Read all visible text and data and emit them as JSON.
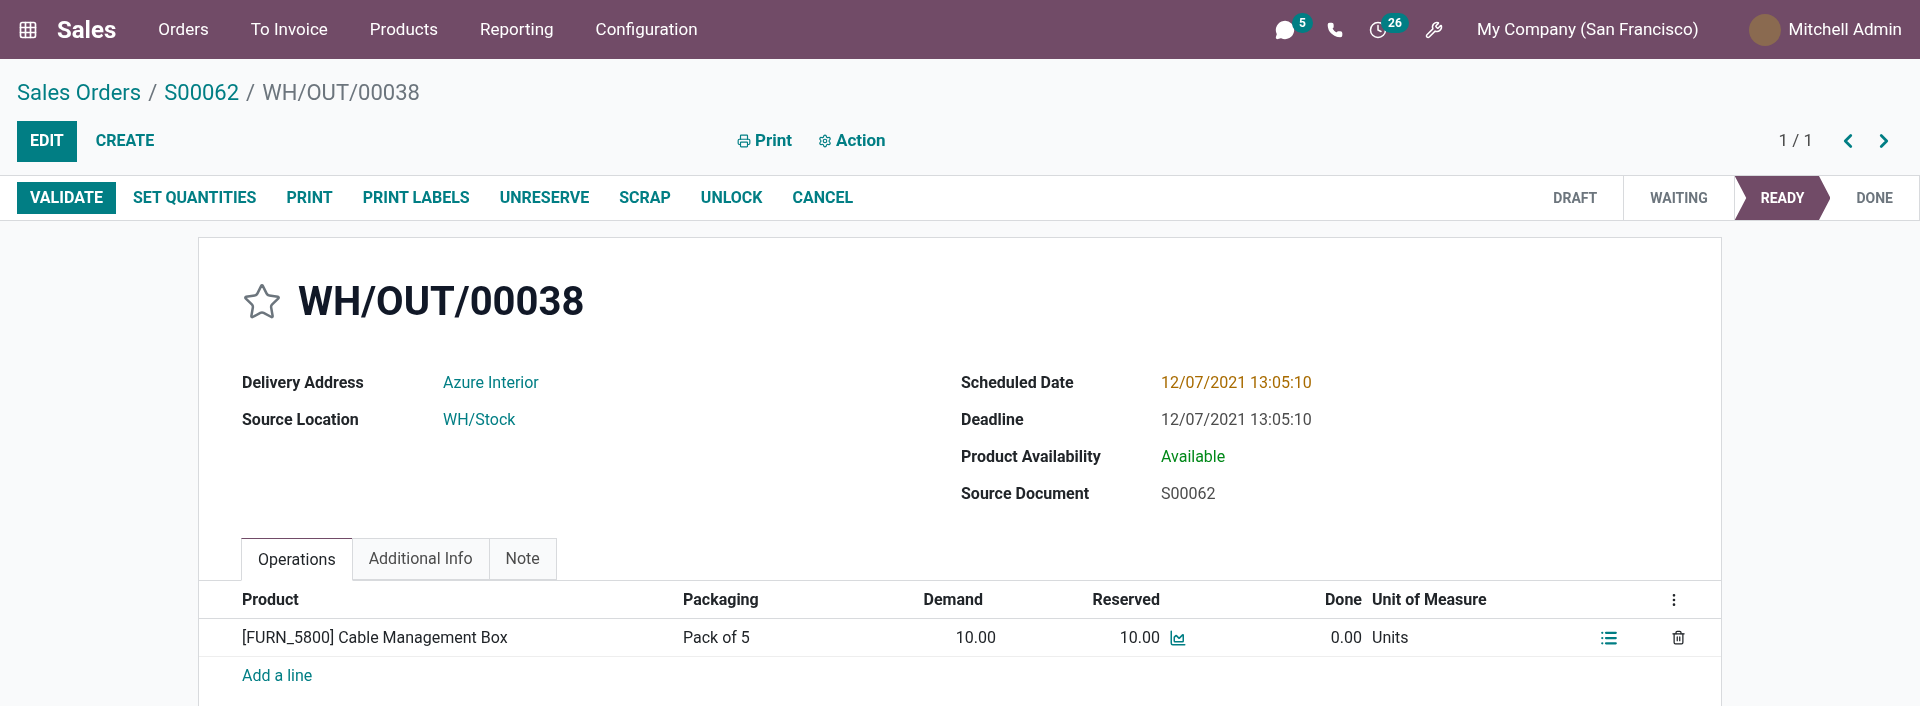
{
  "navbar": {
    "app": "Sales",
    "menu": [
      "Orders",
      "To Invoice",
      "Products",
      "Reporting",
      "Configuration"
    ],
    "messages_count": "5",
    "activities_count": "26",
    "company": "My Company (San Francisco)",
    "user": "Mitchell Admin"
  },
  "breadcrumb": [
    {
      "label": "Sales Orders",
      "kind": "link"
    },
    {
      "label": "/",
      "kind": "separator"
    },
    {
      "label": "S00062",
      "kind": "link"
    },
    {
      "label": "/",
      "kind": "separator"
    },
    {
      "label": "WH/OUT/00038",
      "kind": "current"
    }
  ],
  "control_buttons": [
    {
      "label": "EDIT",
      "primary": true
    },
    {
      "label": "CREATE",
      "primary": false
    }
  ],
  "action_menus": [
    {
      "label": "Print",
      "kind": "print"
    },
    {
      "label": "Action",
      "kind": "gear"
    }
  ],
  "pager": "1 / 1",
  "header_buttons": [
    {
      "label": "VALIDATE",
      "primary": true
    },
    {
      "label": "SET QUANTITIES",
      "primary": false
    },
    {
      "label": "PRINT",
      "primary": false
    },
    {
      "label": "PRINT LABELS",
      "primary": false
    },
    {
      "label": "UNRESERVE",
      "primary": false
    },
    {
      "label": "SCRAP",
      "primary": false
    },
    {
      "label": "UNLOCK",
      "primary": false
    },
    {
      "label": "CANCEL",
      "primary": false
    }
  ],
  "statusbar": [
    {
      "label": "DRAFT",
      "selected": false
    },
    {
      "label": "WAITING",
      "selected": false
    },
    {
      "label": "READY",
      "selected": true
    },
    {
      "label": "DONE",
      "selected": false
    }
  ],
  "record": {
    "title": "WH/OUT/00038",
    "starred": false,
    "left_fields": [
      {
        "label": "Delivery Address",
        "value": "Azure Interior",
        "kind": "link"
      },
      {
        "label": "Source Location",
        "value": "WH/Stock",
        "kind": "link"
      }
    ],
    "right_fields": [
      {
        "label": "Scheduled Date",
        "value": "12/07/2021 13:05:10",
        "kind": "warning"
      },
      {
        "label": "Deadline",
        "value": "12/07/2021 13:05:10",
        "kind": "plain"
      },
      {
        "label": "Product Availability",
        "value": "Available",
        "kind": "success"
      },
      {
        "label": "Source Document",
        "value": "S00062",
        "kind": "plain"
      }
    ]
  },
  "tabs": [
    {
      "label": "Operations",
      "selected": true
    },
    {
      "label": "Additional Info",
      "selected": false
    },
    {
      "label": "Note",
      "selected": false
    }
  ],
  "table": {
    "columns": [
      "Product",
      "Packaging",
      "Demand",
      "Reserved",
      "Done",
      "Unit of Measure"
    ],
    "rows": [
      {
        "product": "[FURN_5800] Cable Management Box",
        "packaging": "Pack of 5",
        "demand": "10.00",
        "reserved": "10.00",
        "done": "0.00",
        "uom": "Units"
      }
    ],
    "add_line": "Add a line"
  }
}
